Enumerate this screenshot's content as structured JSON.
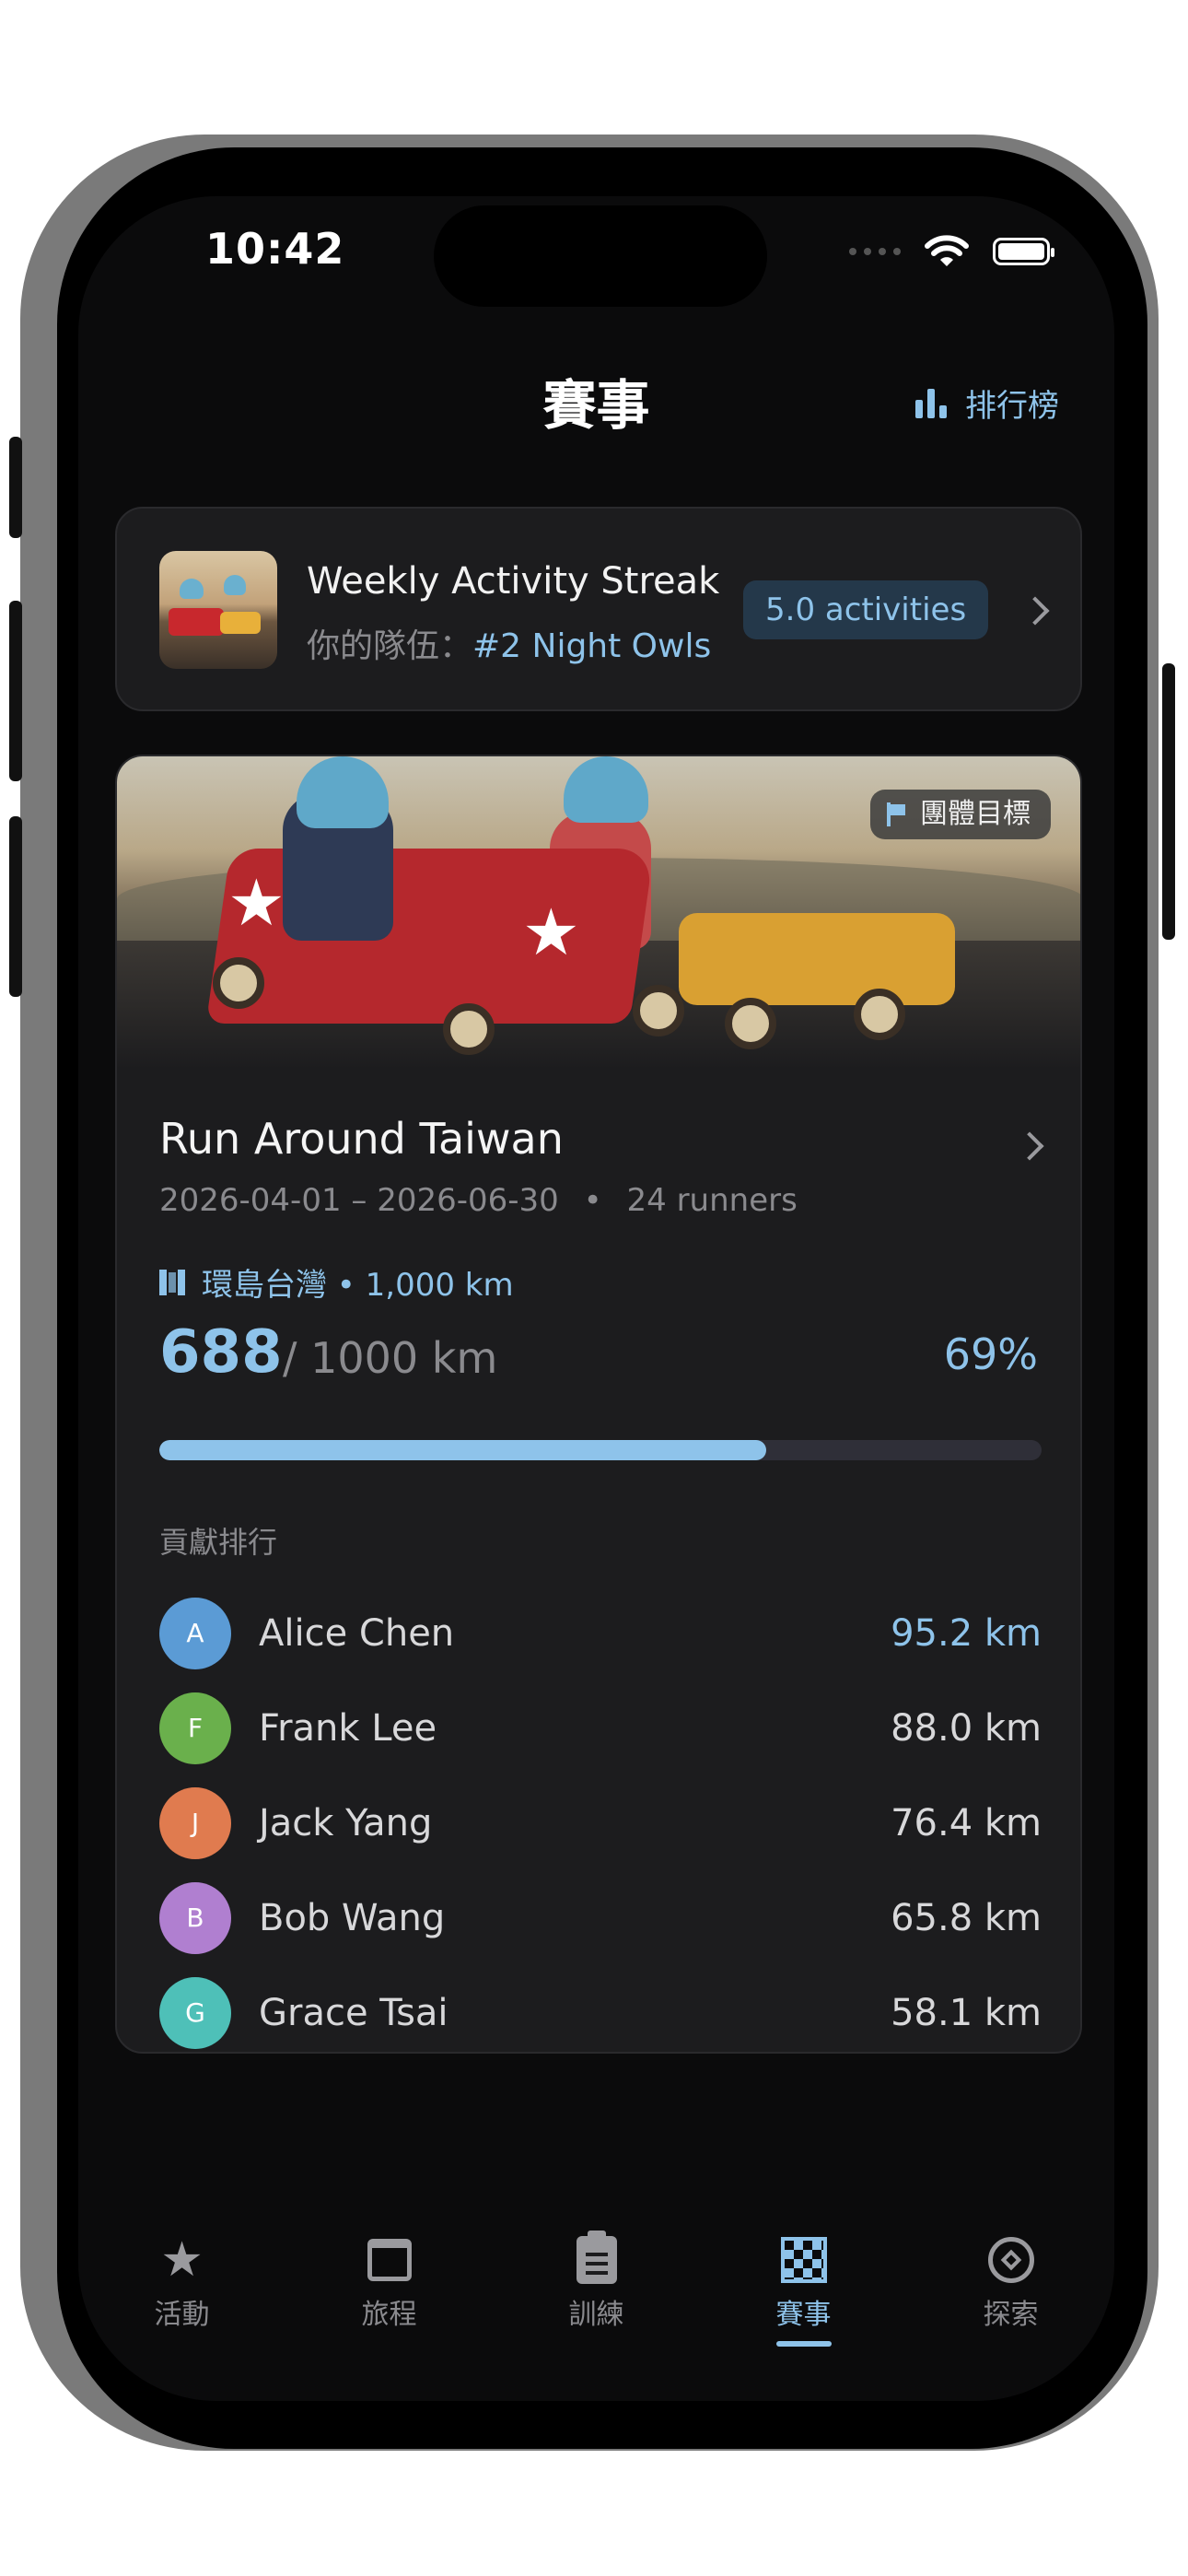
{
  "status_bar": {
    "time": "10:42"
  },
  "header": {
    "title": "賽事",
    "leaderboard_label": "排行榜"
  },
  "streak_card": {
    "title": "Weekly Activity Streak",
    "team_prefix": "你的隊伍：",
    "team_rank": "#2 Night Owls",
    "activities_pill": "5.0 activities"
  },
  "challenge": {
    "badge": "團體目標",
    "title": "Run Around Taiwan",
    "dates": "2026-04-01 – 2026-06-30",
    "separator": "•",
    "runners": "24 runners",
    "route": "環島台灣 • 1,000 km",
    "progress_current": "688",
    "progress_total": "/ 1000 km",
    "progress_percent": "69%",
    "progress_fraction": 0.688,
    "contrib_label": "貢獻排行",
    "contributors": [
      {
        "initial": "A",
        "name": "Alice Chen",
        "km": "95.2 km",
        "color": "#5b9bd5"
      },
      {
        "initial": "F",
        "name": "Frank Lee",
        "km": "88.0 km",
        "color": "#6ab04c"
      },
      {
        "initial": "J",
        "name": "Jack Yang",
        "km": "76.4 km",
        "color": "#e07b4f"
      },
      {
        "initial": "B",
        "name": "Bob Wang",
        "km": "65.8 km",
        "color": "#b07fd0"
      },
      {
        "initial": "G",
        "name": "Grace Tsai",
        "km": "58.1 km",
        "color": "#4ec0b8"
      }
    ]
  },
  "tabs": [
    {
      "label": "活動",
      "icon": "star-icon"
    },
    {
      "label": "旅程",
      "icon": "calendar-icon"
    },
    {
      "label": "訓練",
      "icon": "clipboard-icon"
    },
    {
      "label": "賽事",
      "icon": "checkered-flag-icon",
      "active": true
    },
    {
      "label": "探索",
      "icon": "compass-icon"
    }
  ],
  "colors": {
    "accent": "#8ec3ea",
    "card": "#1c1c1e",
    "background": "#0b0b0c"
  }
}
